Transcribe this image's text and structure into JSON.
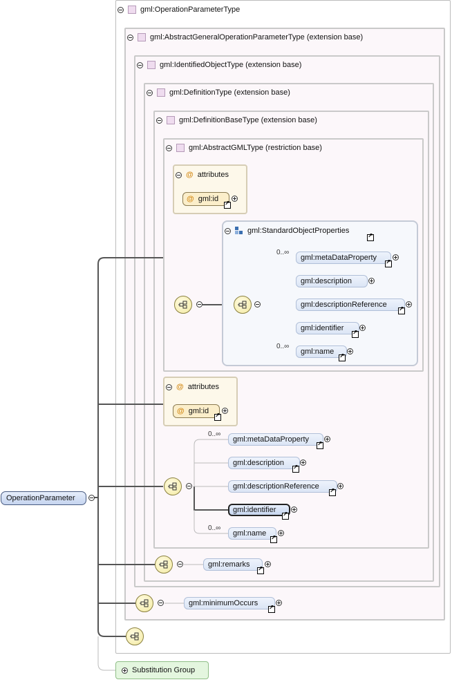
{
  "types": {
    "operation_parameter_type": "gml:OperationParameterType",
    "abstract_general": "gml:AbstractGeneralOperationParameterType (extension base)",
    "identified_object": "gml:IdentifiedObjectType (extension base)",
    "definition_type": "gml:DefinitionType (extension base)",
    "definition_base": "gml:DefinitionBaseType (extension base)",
    "abstract_gml": "gml:AbstractGMLType (restriction base)"
  },
  "attributes": {
    "label": "attributes",
    "at_symbol": "@",
    "id_attr": "gml:id"
  },
  "standard_props": {
    "title": "gml:StandardObjectProperties",
    "items": [
      "gml:metaDataProperty",
      "gml:description",
      "gml:descriptionReference",
      "gml:identifier",
      "gml:name"
    ]
  },
  "occurrence": {
    "many": "0..∞"
  },
  "definition_base_items": [
    "gml:metaDataProperty",
    "gml:description",
    "gml:descriptionReference",
    "gml:identifier",
    "gml:name"
  ],
  "remarks": "gml:remarks",
  "minimum_occurs": "gml:minimumOccurs",
  "root_element": "OperationParameter",
  "substitution_group": "Substitution Group",
  "colors": {
    "element_fill": "#c7d6ef",
    "type_border": "#c9c9c9",
    "attribute_fill": "#fbeeca",
    "substitution_fill": "#e4f6df"
  }
}
